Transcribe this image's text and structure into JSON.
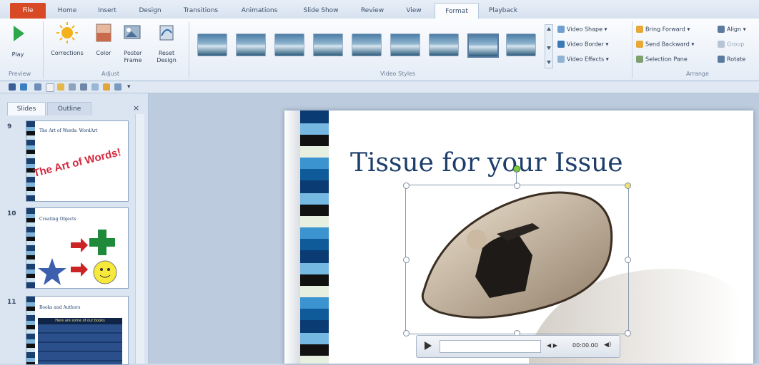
{
  "tabs": [
    "File",
    "Home",
    "Insert",
    "Design",
    "Transitions",
    "Animations",
    "Slide Show",
    "Review",
    "View",
    "Format",
    "Playback"
  ],
  "ribbon": {
    "preview": {
      "play_label": "Play",
      "group": "Preview"
    },
    "adjust": {
      "corrections": "Corrections",
      "color": "Color",
      "poster_frame": "Poster\nFrame",
      "reset_design": "Reset\nDesign",
      "group": "Adjust"
    },
    "video_styles": {
      "group": "Video Styles"
    },
    "video_commands": {
      "shape": "Video Shape",
      "border": "Video Border",
      "effects": "Video Effects"
    },
    "arrange": {
      "bring_forward": "Bring Forward",
      "send_backward": "Send Backward",
      "selection_pane": "Selection Pane",
      "align": "Align",
      "group": "Group",
      "rotate": "Rotate",
      "group_label": "Arrange"
    }
  },
  "panel": {
    "tab_slides": "Slides",
    "tab_outline": "Outline",
    "close": "×",
    "slides": [
      {
        "num": "9",
        "title": "The Art of Words: WordArt",
        "art": "The Art of Words!"
      },
      {
        "num": "10",
        "title": "Creating Objects"
      },
      {
        "num": "11",
        "title": "Books and Authors",
        "table_header": "Here are some of our books"
      }
    ]
  },
  "slide": {
    "title": "Tissue for your Issue"
  },
  "player": {
    "time": "00:00.00"
  },
  "colors": {
    "file_tab": "#d84a26",
    "accent": "#1d3e6b"
  }
}
